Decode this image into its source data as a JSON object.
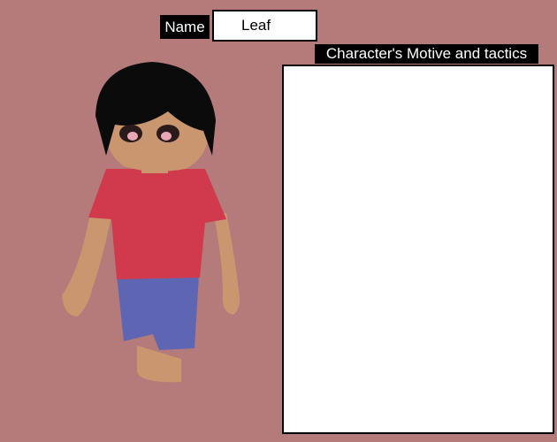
{
  "name": {
    "label": "Name",
    "value": "Leaf"
  },
  "motive": {
    "label": "Character's Motive and tactics",
    "value": ""
  },
  "character_image": {
    "description_icon": "character-figure-icon"
  }
}
